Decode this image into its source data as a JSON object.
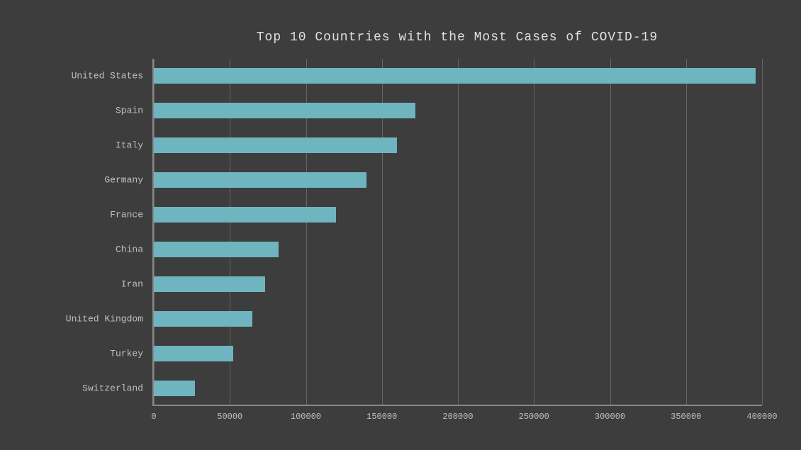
{
  "title": "Top 10 Countries with the Most Cases of COVID-19",
  "chart": {
    "max_value": 400000,
    "x_labels": [
      "0",
      "50000",
      "100000",
      "150000",
      "200000",
      "250000",
      "300000",
      "350000",
      "400000"
    ],
    "countries": [
      {
        "name": "United States",
        "value": 396000
      },
      {
        "name": "Spain",
        "value": 172000
      },
      {
        "name": "Italy",
        "value": 160000
      },
      {
        "name": "Germany",
        "value": 140000
      },
      {
        "name": "France",
        "value": 120000
      },
      {
        "name": "China",
        "value": 82000
      },
      {
        "name": "Iran",
        "value": 73000
      },
      {
        "name": "United Kingdom",
        "value": 65000
      },
      {
        "name": "Turkey",
        "value": 52000
      },
      {
        "name": "Switzerland",
        "value": 27000
      }
    ],
    "bar_color": "#6eb5c0",
    "grid_line_color": "rgba(180,180,180,0.35)",
    "bg_color": "#3d3d3d",
    "text_color": "#c0c0c0"
  }
}
